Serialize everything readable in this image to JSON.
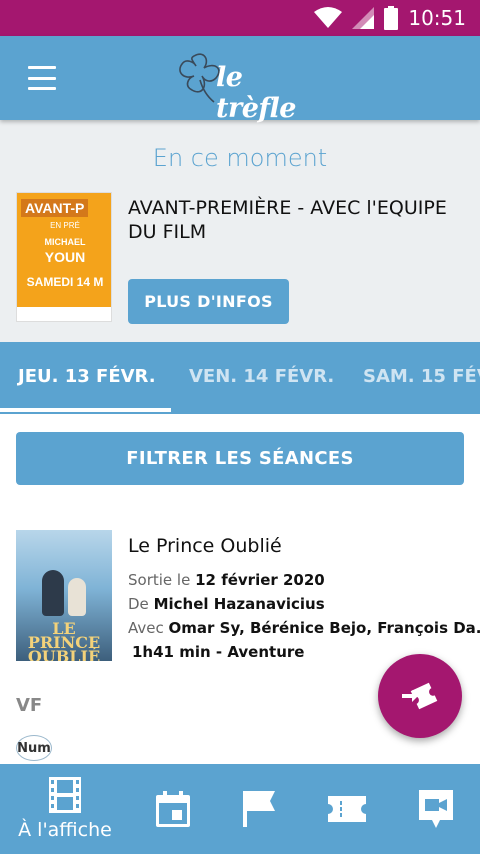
{
  "status_bar": {
    "time": "10:51"
  },
  "app_bar": {
    "logo_text": "le trèfle"
  },
  "now": {
    "title": "En ce moment",
    "premiere_title": "AVANT-PREMIÈRE - AVEC l'EQUIPE DU FILM",
    "poster": {
      "line1": "AVANT-P",
      "line2": "EN PRÉ",
      "name1": "MICHAEL",
      "name2": "YOUN",
      "date": "SAMEDI 14 M"
    },
    "more_button": "PLUS D'INFOS"
  },
  "date_tabs": [
    {
      "label": "JEU. 13 FÉVR.",
      "active": true
    },
    {
      "label": "VEN. 14 FÉVR.",
      "active": false
    },
    {
      "label": "SAM. 15 FÉV",
      "active": false
    }
  ],
  "filter_button": "FILTRER LES SÉANCES",
  "film": {
    "title": "Le Prince Oublié",
    "poster_title": "LE PRINCE OUBLIÉ",
    "release_prefix": "Sortie le",
    "release_date": "12 février 2020",
    "director_prefix": "De",
    "director": "Michel Hazanavicius",
    "cast_prefix": "Avec",
    "cast": "Omar Sy, Bérénice Bejo, François Da...",
    "meta": "1h41 min - Aventure"
  },
  "version": {
    "label": "VF",
    "badge": "Num"
  },
  "bottom_nav": {
    "active_label": "À l'affiche",
    "items": [
      "film-strip-icon",
      "calendar-icon",
      "flag-icon",
      "ticket-icon",
      "video-message-icon"
    ]
  },
  "colors": {
    "primary": "#5ba3d0",
    "accent": "#a4176f",
    "background": "#eceff1"
  }
}
